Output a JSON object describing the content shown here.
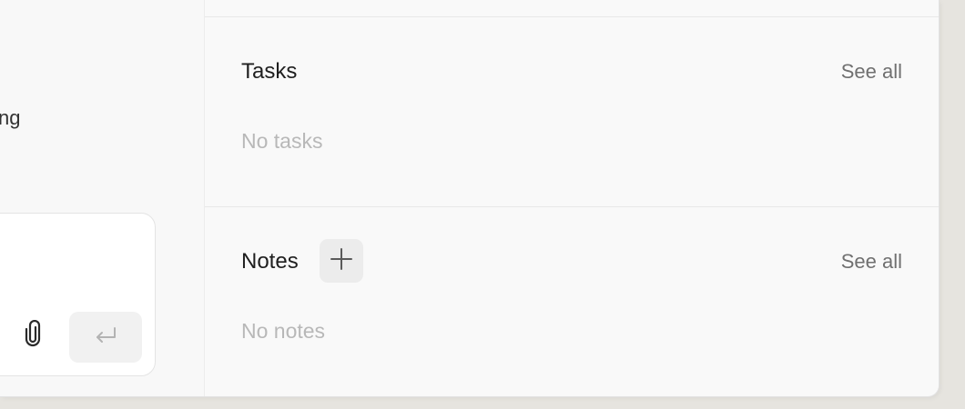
{
  "left_pane": {
    "truncated_text": "ng"
  },
  "composer": {
    "attach_icon": "paperclip-icon",
    "send_icon": "return-arrow-icon"
  },
  "tasks": {
    "title": "Tasks",
    "see_all": "See all",
    "empty": "No tasks"
  },
  "notes": {
    "title": "Notes",
    "add_icon": "plus-icon",
    "see_all": "See all",
    "empty": "No notes"
  },
  "colors": {
    "panel_background": "#f9f9f9",
    "title_text": "#1f1f1f",
    "muted_text": "#707070",
    "placeholder_text": "#b8b8b8",
    "button_background": "#ececec"
  }
}
